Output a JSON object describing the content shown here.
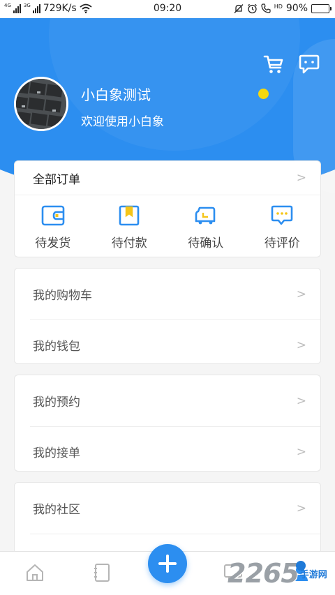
{
  "status_bar": {
    "network_tags": [
      "4G",
      "3G"
    ],
    "speed": "729K/s",
    "time": "09:20",
    "hd_tag": "HD",
    "battery_text": "90%",
    "battery_level": 0.9,
    "icons": [
      "signal-icon",
      "wifi-icon",
      "mute-bell-icon",
      "alarm-icon",
      "call-icon",
      "battery-icon"
    ]
  },
  "header": {
    "user_name": "小白象测试",
    "welcome": "欢迎使用小白象",
    "icons": [
      "cart-icon",
      "message-icon"
    ],
    "colors": {
      "primary": "#2c8ef0",
      "dot": "#f5d80e"
    }
  },
  "orders": {
    "title": "全部订单",
    "chevron": ">",
    "items": [
      {
        "label": "待发货",
        "icon": "wallet-icon"
      },
      {
        "label": "待付款",
        "icon": "bookmark-icon"
      },
      {
        "label": "待确认",
        "icon": "truck-icon"
      },
      {
        "label": "待评价",
        "icon": "comment-icon"
      }
    ]
  },
  "menu": {
    "group_a": [
      {
        "label": "我的购物车"
      },
      {
        "label": "我的钱包"
      }
    ],
    "group_b": [
      {
        "label": "我的预约"
      },
      {
        "label": "我的接单"
      }
    ],
    "group_c": [
      {
        "label": "我的社区"
      }
    ],
    "chevron": ">"
  },
  "bottom_nav": {
    "icons": [
      "home-icon",
      "book-icon",
      "add-icon",
      "chat-icon",
      "user-icon"
    ]
  },
  "watermark": {
    "number": "2265",
    "text": "手游网"
  }
}
